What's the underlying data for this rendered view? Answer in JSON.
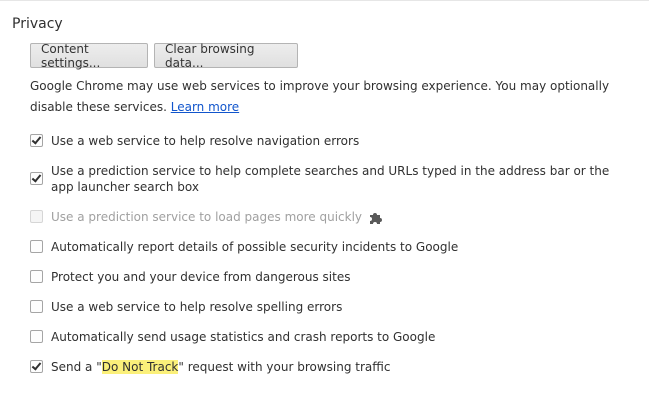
{
  "privacy": {
    "title": "Privacy",
    "content_settings_label": "Content settings...",
    "clear_browsing_label": "Clear browsing data...",
    "description": "Google Chrome may use web services to improve your browsing experience. You may optionally disable these services.",
    "learn_more": "Learn more"
  },
  "options": [
    {
      "label": "Use a web service to help resolve navigation errors",
      "checked": true,
      "disabled": false
    },
    {
      "label": "Use a prediction service to help complete searches and URLs typed in the address bar or the app launcher search box",
      "checked": true,
      "disabled": false
    },
    {
      "label": "Use a prediction service to load pages more quickly",
      "checked": false,
      "disabled": true,
      "icon": "puzzle-piece-icon"
    },
    {
      "label": "Automatically report details of possible security incidents to Google",
      "checked": false,
      "disabled": false
    },
    {
      "label": "Protect you and your device from dangerous sites",
      "checked": false,
      "disabled": false
    },
    {
      "label": "Use a web service to help resolve spelling errors",
      "checked": false,
      "disabled": false
    },
    {
      "label": "Automatically send usage statistics and crash reports to Google",
      "checked": false,
      "disabled": false
    },
    {
      "label_before": "Send a \"",
      "label_highlight": "Do Not Track",
      "label_after": "\" request with your browsing traffic",
      "checked": true,
      "disabled": false
    }
  ],
  "colors": {
    "link": "#1155cc",
    "highlight": "#fbf07a"
  }
}
